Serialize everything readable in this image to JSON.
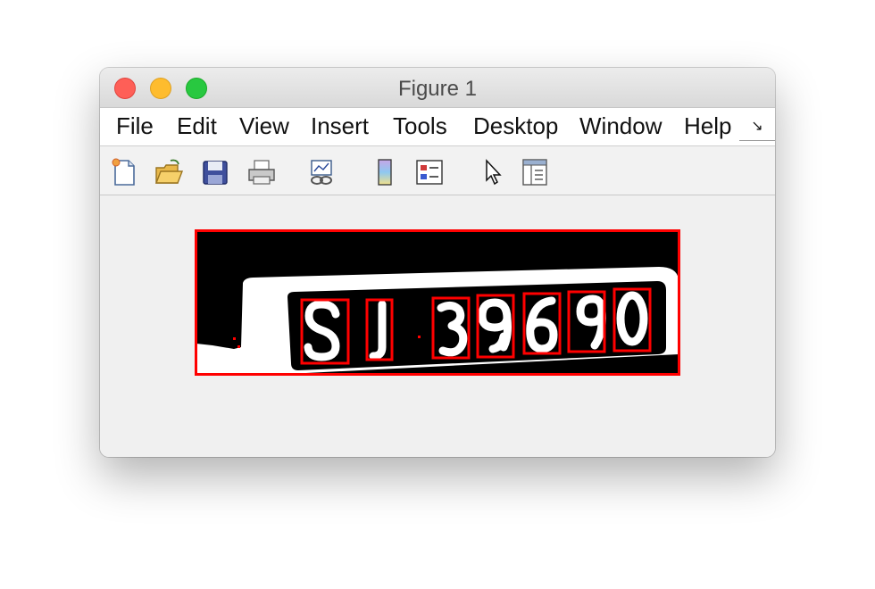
{
  "window": {
    "title": "Figure 1"
  },
  "menubar": {
    "items": [
      "File",
      "Edit",
      "View",
      "Insert",
      "Tools",
      "Desktop",
      "Window",
      "Help"
    ],
    "overflow_icon": "double-chevron-icon"
  },
  "toolbar": {
    "buttons": [
      "new-figure-icon",
      "open-file-icon",
      "save-icon",
      "print-icon",
      "link-plot-icon",
      "insert-colorbar-icon",
      "insert-legend-icon",
      "edit-plot-pointer-icon",
      "property-inspector-icon"
    ]
  },
  "image": {
    "description_type": "binary-license-plate",
    "box_color": "#ff0000",
    "characters": [
      "S",
      "J",
      "3",
      "9",
      "6",
      "9",
      "0"
    ]
  }
}
